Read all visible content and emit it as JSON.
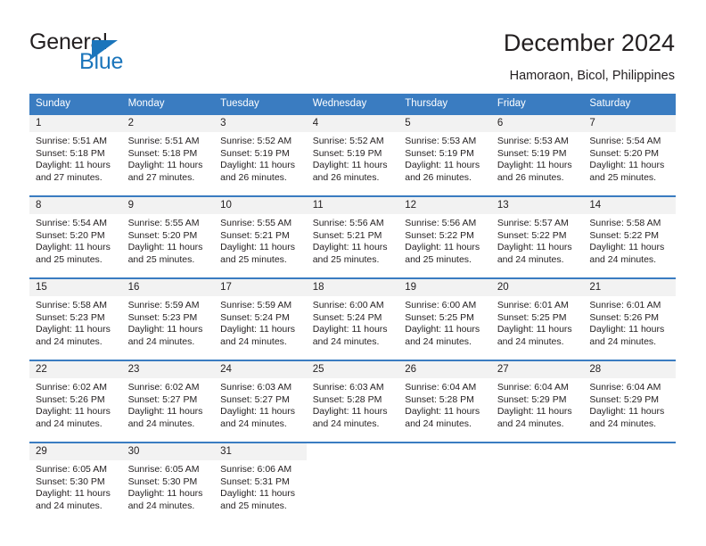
{
  "logo": {
    "word_one": "General",
    "word_two": "Blue"
  },
  "header": {
    "title": "December 2024",
    "subtitle": "Hamoraon, Bicol, Philippines"
  },
  "calendar": {
    "weekday_headers": [
      "Sunday",
      "Monday",
      "Tuesday",
      "Wednesday",
      "Thursday",
      "Friday",
      "Saturday"
    ],
    "colors": {
      "header_blue": "#3a7cc1",
      "daynum_band": "#f2f2f2",
      "logo_blue": "#1b75bb",
      "text": "#231f20"
    },
    "weeks": [
      [
        {
          "day": "1",
          "sunrise": "Sunrise: 5:51 AM",
          "sunset": "Sunset: 5:18 PM",
          "daylight_1": "Daylight: 11 hours",
          "daylight_2": "and 27 minutes."
        },
        {
          "day": "2",
          "sunrise": "Sunrise: 5:51 AM",
          "sunset": "Sunset: 5:18 PM",
          "daylight_1": "Daylight: 11 hours",
          "daylight_2": "and 27 minutes."
        },
        {
          "day": "3",
          "sunrise": "Sunrise: 5:52 AM",
          "sunset": "Sunset: 5:19 PM",
          "daylight_1": "Daylight: 11 hours",
          "daylight_2": "and 26 minutes."
        },
        {
          "day": "4",
          "sunrise": "Sunrise: 5:52 AM",
          "sunset": "Sunset: 5:19 PM",
          "daylight_1": "Daylight: 11 hours",
          "daylight_2": "and 26 minutes."
        },
        {
          "day": "5",
          "sunrise": "Sunrise: 5:53 AM",
          "sunset": "Sunset: 5:19 PM",
          "daylight_1": "Daylight: 11 hours",
          "daylight_2": "and 26 minutes."
        },
        {
          "day": "6",
          "sunrise": "Sunrise: 5:53 AM",
          "sunset": "Sunset: 5:19 PM",
          "daylight_1": "Daylight: 11 hours",
          "daylight_2": "and 26 minutes."
        },
        {
          "day": "7",
          "sunrise": "Sunrise: 5:54 AM",
          "sunset": "Sunset: 5:20 PM",
          "daylight_1": "Daylight: 11 hours",
          "daylight_2": "and 25 minutes."
        }
      ],
      [
        {
          "day": "8",
          "sunrise": "Sunrise: 5:54 AM",
          "sunset": "Sunset: 5:20 PM",
          "daylight_1": "Daylight: 11 hours",
          "daylight_2": "and 25 minutes."
        },
        {
          "day": "9",
          "sunrise": "Sunrise: 5:55 AM",
          "sunset": "Sunset: 5:20 PM",
          "daylight_1": "Daylight: 11 hours",
          "daylight_2": "and 25 minutes."
        },
        {
          "day": "10",
          "sunrise": "Sunrise: 5:55 AM",
          "sunset": "Sunset: 5:21 PM",
          "daylight_1": "Daylight: 11 hours",
          "daylight_2": "and 25 minutes."
        },
        {
          "day": "11",
          "sunrise": "Sunrise: 5:56 AM",
          "sunset": "Sunset: 5:21 PM",
          "daylight_1": "Daylight: 11 hours",
          "daylight_2": "and 25 minutes."
        },
        {
          "day": "12",
          "sunrise": "Sunrise: 5:56 AM",
          "sunset": "Sunset: 5:22 PM",
          "daylight_1": "Daylight: 11 hours",
          "daylight_2": "and 25 minutes."
        },
        {
          "day": "13",
          "sunrise": "Sunrise: 5:57 AM",
          "sunset": "Sunset: 5:22 PM",
          "daylight_1": "Daylight: 11 hours",
          "daylight_2": "and 24 minutes."
        },
        {
          "day": "14",
          "sunrise": "Sunrise: 5:58 AM",
          "sunset": "Sunset: 5:22 PM",
          "daylight_1": "Daylight: 11 hours",
          "daylight_2": "and 24 minutes."
        }
      ],
      [
        {
          "day": "15",
          "sunrise": "Sunrise: 5:58 AM",
          "sunset": "Sunset: 5:23 PM",
          "daylight_1": "Daylight: 11 hours",
          "daylight_2": "and 24 minutes."
        },
        {
          "day": "16",
          "sunrise": "Sunrise: 5:59 AM",
          "sunset": "Sunset: 5:23 PM",
          "daylight_1": "Daylight: 11 hours",
          "daylight_2": "and 24 minutes."
        },
        {
          "day": "17",
          "sunrise": "Sunrise: 5:59 AM",
          "sunset": "Sunset: 5:24 PM",
          "daylight_1": "Daylight: 11 hours",
          "daylight_2": "and 24 minutes."
        },
        {
          "day": "18",
          "sunrise": "Sunrise: 6:00 AM",
          "sunset": "Sunset: 5:24 PM",
          "daylight_1": "Daylight: 11 hours",
          "daylight_2": "and 24 minutes."
        },
        {
          "day": "19",
          "sunrise": "Sunrise: 6:00 AM",
          "sunset": "Sunset: 5:25 PM",
          "daylight_1": "Daylight: 11 hours",
          "daylight_2": "and 24 minutes."
        },
        {
          "day": "20",
          "sunrise": "Sunrise: 6:01 AM",
          "sunset": "Sunset: 5:25 PM",
          "daylight_1": "Daylight: 11 hours",
          "daylight_2": "and 24 minutes."
        },
        {
          "day": "21",
          "sunrise": "Sunrise: 6:01 AM",
          "sunset": "Sunset: 5:26 PM",
          "daylight_1": "Daylight: 11 hours",
          "daylight_2": "and 24 minutes."
        }
      ],
      [
        {
          "day": "22",
          "sunrise": "Sunrise: 6:02 AM",
          "sunset": "Sunset: 5:26 PM",
          "daylight_1": "Daylight: 11 hours",
          "daylight_2": "and 24 minutes."
        },
        {
          "day": "23",
          "sunrise": "Sunrise: 6:02 AM",
          "sunset": "Sunset: 5:27 PM",
          "daylight_1": "Daylight: 11 hours",
          "daylight_2": "and 24 minutes."
        },
        {
          "day": "24",
          "sunrise": "Sunrise: 6:03 AM",
          "sunset": "Sunset: 5:27 PM",
          "daylight_1": "Daylight: 11 hours",
          "daylight_2": "and 24 minutes."
        },
        {
          "day": "25",
          "sunrise": "Sunrise: 6:03 AM",
          "sunset": "Sunset: 5:28 PM",
          "daylight_1": "Daylight: 11 hours",
          "daylight_2": "and 24 minutes."
        },
        {
          "day": "26",
          "sunrise": "Sunrise: 6:04 AM",
          "sunset": "Sunset: 5:28 PM",
          "daylight_1": "Daylight: 11 hours",
          "daylight_2": "and 24 minutes."
        },
        {
          "day": "27",
          "sunrise": "Sunrise: 6:04 AM",
          "sunset": "Sunset: 5:29 PM",
          "daylight_1": "Daylight: 11 hours",
          "daylight_2": "and 24 minutes."
        },
        {
          "day": "28",
          "sunrise": "Sunrise: 6:04 AM",
          "sunset": "Sunset: 5:29 PM",
          "daylight_1": "Daylight: 11 hours",
          "daylight_2": "and 24 minutes."
        }
      ],
      [
        {
          "day": "29",
          "sunrise": "Sunrise: 6:05 AM",
          "sunset": "Sunset: 5:30 PM",
          "daylight_1": "Daylight: 11 hours",
          "daylight_2": "and 24 minutes."
        },
        {
          "day": "30",
          "sunrise": "Sunrise: 6:05 AM",
          "sunset": "Sunset: 5:30 PM",
          "daylight_1": "Daylight: 11 hours",
          "daylight_2": "and 24 minutes."
        },
        {
          "day": "31",
          "sunrise": "Sunrise: 6:06 AM",
          "sunset": "Sunset: 5:31 PM",
          "daylight_1": "Daylight: 11 hours",
          "daylight_2": "and 25 minutes."
        },
        {
          "day": "",
          "sunrise": "",
          "sunset": "",
          "daylight_1": "",
          "daylight_2": ""
        },
        {
          "day": "",
          "sunrise": "",
          "sunset": "",
          "daylight_1": "",
          "daylight_2": ""
        },
        {
          "day": "",
          "sunrise": "",
          "sunset": "",
          "daylight_1": "",
          "daylight_2": ""
        },
        {
          "day": "",
          "sunrise": "",
          "sunset": "",
          "daylight_1": "",
          "daylight_2": ""
        }
      ]
    ]
  }
}
